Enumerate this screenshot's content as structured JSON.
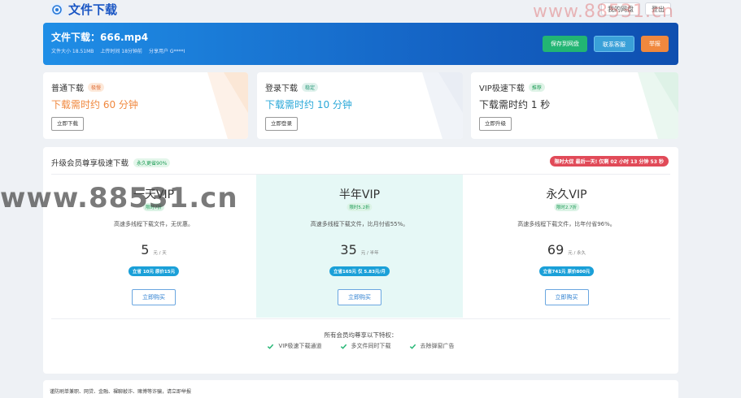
{
  "app": {
    "title": "文件下载",
    "top_buttons": [
      "我的网盘",
      "登出"
    ]
  },
  "watermarks": {
    "top": "www.88531.cn",
    "middle": "www.88531.cn"
  },
  "banner": {
    "title": "文件下载：666.mp4",
    "meta": [
      "文件大小 18.51MB",
      "上传时间 18分钟前",
      "分享用户 G****I"
    ],
    "buttons": {
      "save": "保存到网盘",
      "contact": "联系客服",
      "report": "举报"
    }
  },
  "options": [
    {
      "name": "普通下载",
      "tag": "极慢",
      "time": "下载需时约 60 分钟",
      "button": "立即下载",
      "color": "#f0883e",
      "tag_bg": "#fde9da",
      "tag_color": "#e0703a"
    },
    {
      "name": "登录下载",
      "tag": "稳定",
      "time": "下载需时约 10 分钟",
      "button": "立即登录",
      "color": "#2aa8d8",
      "tag_bg": "#dff1ec",
      "tag_color": "#2a9a7a"
    },
    {
      "name": "VIP极速下载",
      "tag": "推荐",
      "time": "下载需时约 1 秒",
      "button": "立即升级",
      "color": "#333333",
      "tag_bg": "#dff3e7",
      "tag_color": "#1f9d58"
    }
  ],
  "vip": {
    "title": "升级会员尊享极速下载",
    "title_tag": "永久更省90%",
    "countdown": "限时大促 最后一天! 仅剩 02 小时 13 分钟 53 秒",
    "plans": [
      {
        "name": "一天VIP",
        "tag": "限时7折",
        "desc": "高速多线程下载文件，无优惠。",
        "price": "5",
        "unit": "元 / 天",
        "save": "立省 10元 原价15元",
        "button": "立即购买"
      },
      {
        "name": "半年VIP",
        "tag": "限时5.2折",
        "desc": "高速多线程下载文件，比月付省55%。",
        "price": "35",
        "unit": "元 / 半年",
        "save": "立省165元 仅 5.83元/月",
        "button": "立即购买"
      },
      {
        "name": "永久VIP",
        "tag": "限时2.7折",
        "desc": "高速多线程下载文件，比年付省96%。",
        "price": "69",
        "unit": "元 / 永久",
        "save": "立省741元 原价800元",
        "button": "立即购买"
      }
    ],
    "privileges_title": "所有会员均尊享以下特权：",
    "privileges": [
      "VIP极速下载通道",
      "多文件同时下载",
      "去除弹窗广告"
    ]
  },
  "footer_note": "谨防刷单兼职、网贷、金融、裸聊敲诈、赌博等诈骗，请立即举报"
}
